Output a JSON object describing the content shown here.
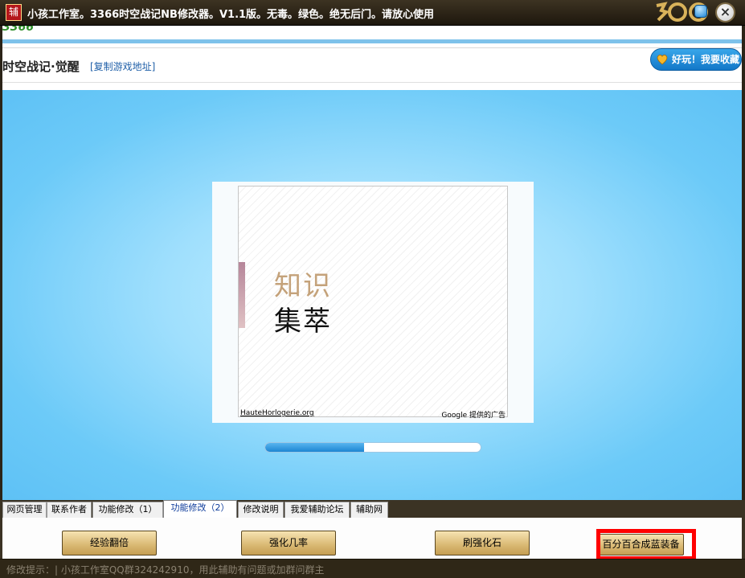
{
  "window": {
    "icon_char": "辅",
    "title": "小孩工作室。3366时空战记NB修改器。V1.1版。无毒。绿色。绝无后门。请放心使用",
    "close_label": "×"
  },
  "site": {
    "logo": "3366"
  },
  "game_bar": {
    "title": "时空战记·觉醒",
    "copy_link": "[复制游戏地址]",
    "favorite_button": "好玩！我要收藏"
  },
  "ad": {
    "line1": "知识",
    "line2": "集萃",
    "link": "HauteHorlogerie.org",
    "provider": "Google 提供的广告"
  },
  "loading": {
    "progress": 0.46
  },
  "tabs": [
    {
      "label": "网页管理"
    },
    {
      "label": "联系作者"
    },
    {
      "label": "功能修改（1）"
    },
    {
      "label": "功能修改（2）"
    },
    {
      "label": "修改说明"
    },
    {
      "label": "我爱辅助论坛"
    },
    {
      "label": "辅助网"
    }
  ],
  "active_tab": 3,
  "buttons": [
    {
      "label": "经验翻倍"
    },
    {
      "label": "强化几率"
    },
    {
      "label": "刷强化石"
    },
    {
      "label": "百分百合成蓝装备"
    }
  ],
  "status": {
    "text": "修改提示：| 小孩工作室QQ群324242910，用此辅助有问题或加群问群主"
  }
}
